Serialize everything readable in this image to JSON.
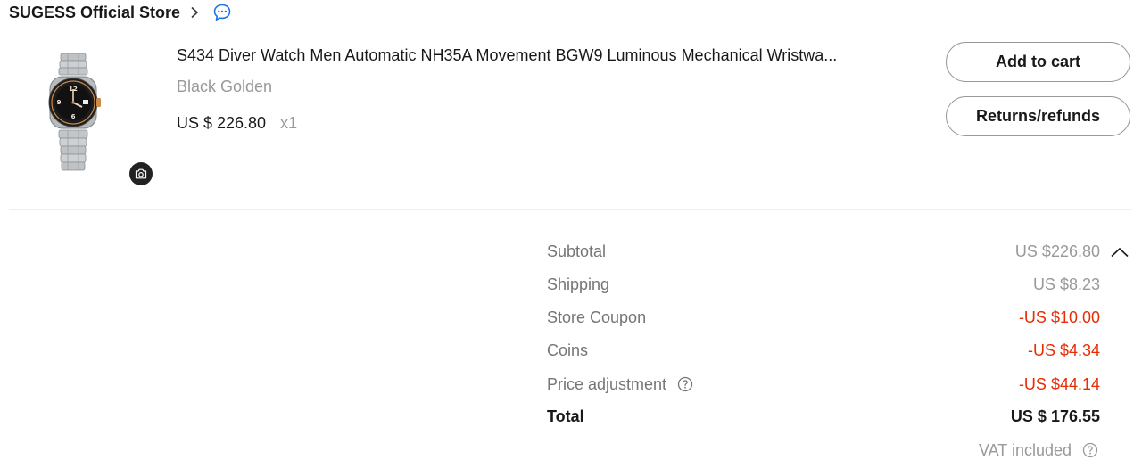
{
  "store": {
    "name": "SUGESS Official Store"
  },
  "product": {
    "title": "S434 Diver Watch Men Automatic NH35A Movement BGW9 Luminous Mechanical Wristwa...",
    "variant": "Black Golden",
    "price": "US $ 226.80",
    "quantity": "x1"
  },
  "actions": {
    "add_to_cart": "Add to cart",
    "returns_refunds": "Returns/refunds"
  },
  "summary": {
    "subtotal_label": "Subtotal",
    "subtotal_value": "US $226.80",
    "shipping_label": "Shipping",
    "shipping_value": "US $8.23",
    "store_coupon_label": "Store Coupon",
    "store_coupon_value": "-US $10.00",
    "coins_label": "Coins",
    "coins_value": "-US $4.34",
    "price_adjustment_label": "Price adjustment",
    "price_adjustment_value": "-US $44.14",
    "total_label": "Total",
    "total_value": "US $ 176.55",
    "vat_label": "VAT included"
  },
  "colors": {
    "text_primary": "#191919",
    "text_secondary": "#999999",
    "discount_red": "#e62e04",
    "chat_blue": "#1a73e8"
  }
}
